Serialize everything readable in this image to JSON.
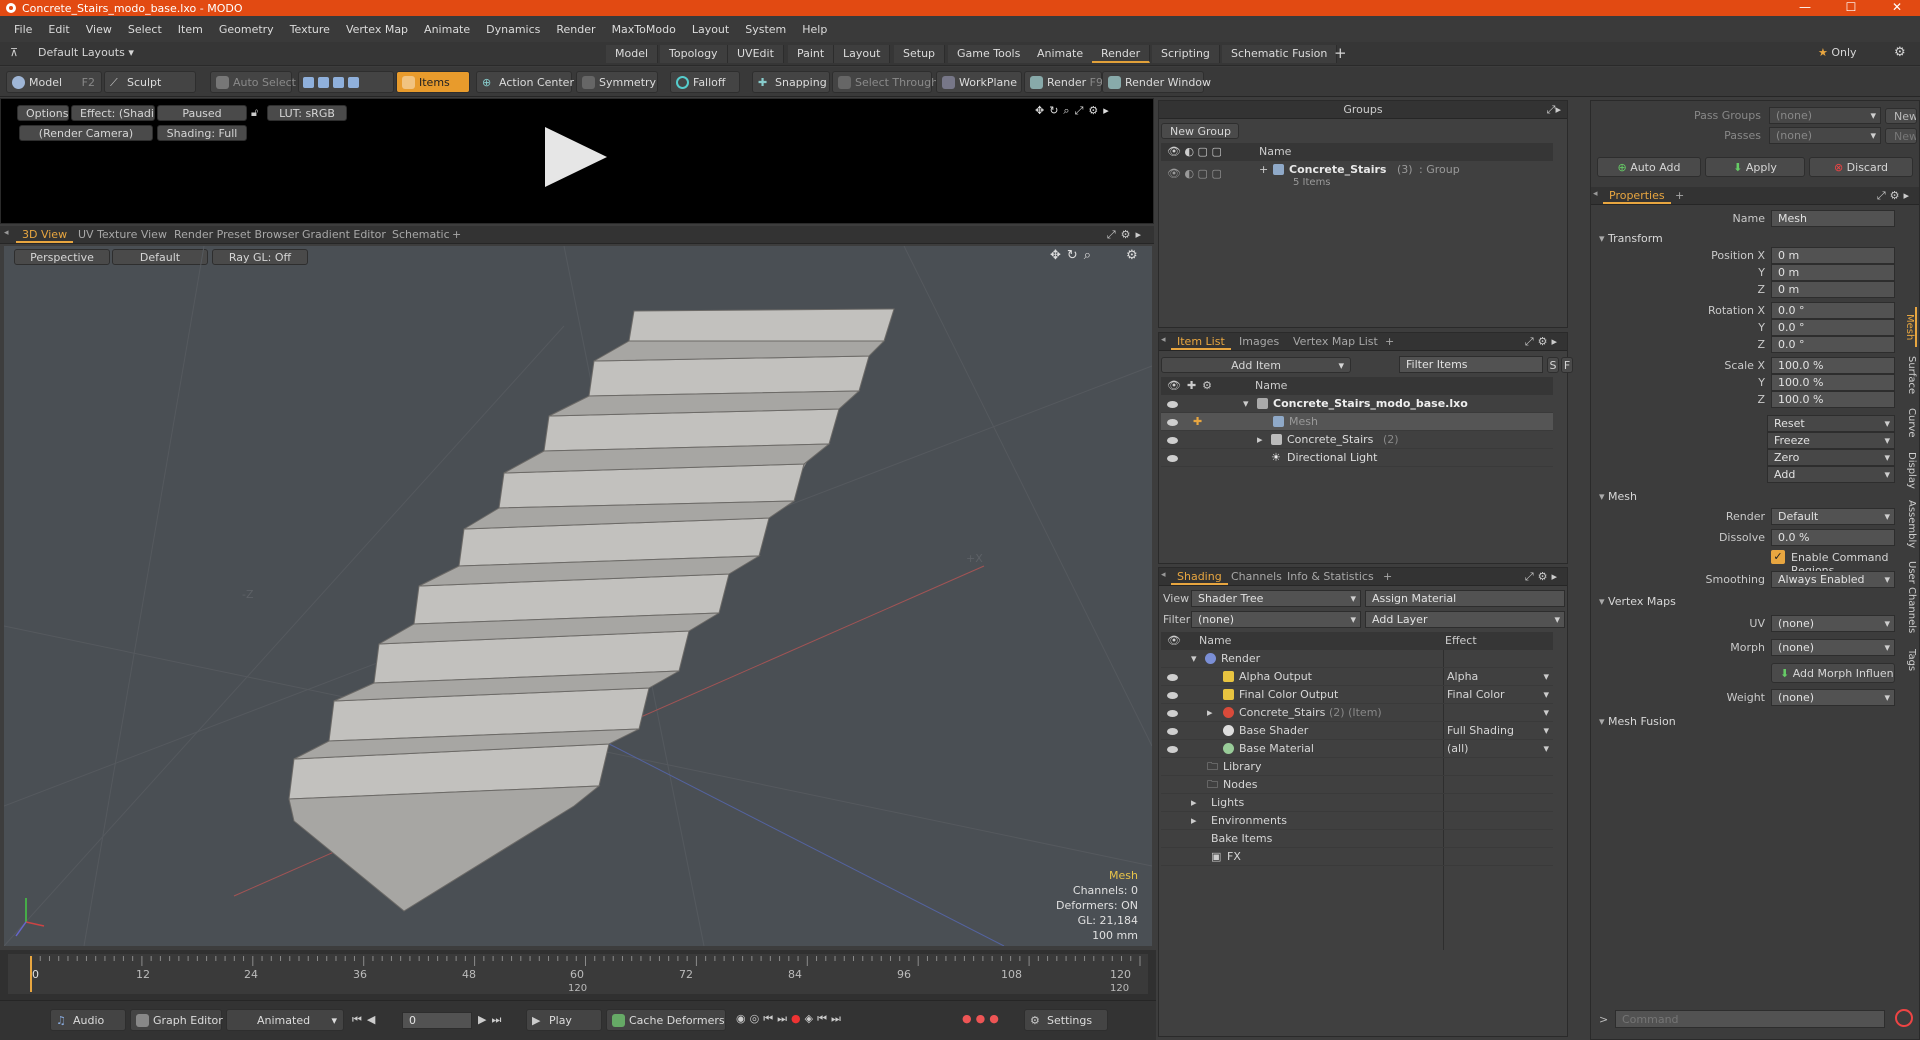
{
  "window": {
    "title": "Concrete_Stairs_modo_base.lxo - MODO"
  },
  "menu": [
    "File",
    "Edit",
    "View",
    "Select",
    "Item",
    "Geometry",
    "Texture",
    "Vertex Map",
    "Animate",
    "Dynamics",
    "Render",
    "MaxToModo",
    "Layout",
    "System",
    "Help"
  ],
  "layout_bar": {
    "preset": "Default Layouts",
    "tabs": [
      "Model",
      "Topology",
      "UVEdit",
      "Paint",
      "Layout",
      "Setup",
      "Game Tools",
      "Animate",
      "Render",
      "Scripting",
      "Schematic Fusion"
    ],
    "active": "Render",
    "only_label": "Only"
  },
  "toolbar": {
    "model": "Model",
    "model_key": "F2",
    "sculpt": "Sculpt",
    "auto_select": "Auto Select",
    "items": "Items",
    "action_center": "Action Center",
    "symmetry": "Symmetry",
    "falloff": "Falloff",
    "snapping": "Snapping",
    "select_through": "Select Through",
    "workplane": "WorkPlane",
    "render": "Render",
    "render_key": "F9",
    "render_window": "Render Window"
  },
  "preview": {
    "options": "Options",
    "effect": "Effect: (Shadi...",
    "paused": "Paused",
    "lut": "LUT: sRGB",
    "camera": "(Render Camera)",
    "shading": "Shading: Full"
  },
  "view_tabs": [
    "3D View",
    "UV Texture View",
    "Render Preset Browser",
    "Gradient Editor",
    "Schematic"
  ],
  "viewport": {
    "projection": "Perspective",
    "style": "Default",
    "raygl": "Ray GL: Off",
    "hud": {
      "type": "Mesh",
      "channels": "Channels: 0",
      "deformers": "Deformers: ON",
      "gl": "GL: 21,184",
      "unit": "100 mm"
    },
    "axis_z": "-Z",
    "axis_x": "+X"
  },
  "timeline": {
    "ticks": [
      "0",
      "12",
      "24",
      "36",
      "48",
      "60",
      "72",
      "84",
      "96",
      "108",
      "120"
    ],
    "mid": "120",
    "end": "120"
  },
  "bottom": {
    "audio": "Audio",
    "graph_editor": "Graph Editor",
    "animated": "Animated",
    "frame": "0",
    "play": "Play",
    "cache": "Cache Deformers",
    "settings": "Settings"
  },
  "groups": {
    "title": "Groups",
    "new_group": "New Group",
    "col_name": "Name",
    "item": "Concrete_Stairs",
    "item_count": "(3)",
    "item_type": ": Group",
    "item_sub": "5 Items"
  },
  "item_list": {
    "tabs": [
      "Item List",
      "Images",
      "Vertex Map List"
    ],
    "add_item": "Add Item",
    "filter": "Filter Items",
    "col_name": "Name",
    "rows": [
      {
        "label": "Concrete_Stairs_modo_base.lxo",
        "suffix": ""
      },
      {
        "label": "Mesh",
        "suffix": ""
      },
      {
        "label": "Concrete_Stairs",
        "suffix": "(2)"
      },
      {
        "label": "Directional Light",
        "suffix": ""
      }
    ]
  },
  "shading": {
    "tabs": [
      "Shading",
      "Channels",
      "Info & Statistics"
    ],
    "view_label": "View",
    "view_value": "Shader Tree",
    "assign": "Assign Material",
    "filter_label": "Filter",
    "filter_value": "(none)",
    "add_layer": "Add Layer",
    "col_name": "Name",
    "col_effect": "Effect",
    "rows": [
      {
        "name": "Render",
        "effect": ""
      },
      {
        "name": "Alpha Output",
        "effect": "Alpha"
      },
      {
        "name": "Final Color Output",
        "effect": "Final Color"
      },
      {
        "name": "Concrete_Stairs",
        "suffix": "(2) (Item)",
        "effect": ""
      },
      {
        "name": "Base Shader",
        "effect": "Full Shading"
      },
      {
        "name": "Base Material",
        "effect": "(all)"
      },
      {
        "name": "Library",
        "effect": ""
      },
      {
        "name": "Nodes",
        "effect": ""
      },
      {
        "name": "Lights",
        "effect": ""
      },
      {
        "name": "Environments",
        "effect": ""
      },
      {
        "name": "Bake Items",
        "effect": ""
      },
      {
        "name": "FX",
        "effect": ""
      }
    ]
  },
  "passes": {
    "pass_groups": "Pass Groups",
    "passes": "Passes",
    "none": "(none)",
    "new": "New",
    "auto_add": "Auto Add",
    "apply": "Apply",
    "discard": "Discard"
  },
  "properties": {
    "tab": "Properties",
    "name_label": "Name",
    "name_value": "Mesh",
    "transform": "Transform",
    "position_label": "Position X",
    "rotation_label": "Rotation X",
    "scale_label": "Scale X",
    "y": "Y",
    "z": "Z",
    "pos": [
      "0 m",
      "0 m",
      "0 m"
    ],
    "rot": [
      "0.0 °",
      "0.0 °",
      "0.0 °"
    ],
    "scale": [
      "100.0 %",
      "100.0 %",
      "100.0 %"
    ],
    "reset": "Reset",
    "freeze": "Freeze",
    "zero": "Zero",
    "add": "Add",
    "mesh": "Mesh",
    "render_label": "Render",
    "render_value": "Default",
    "dissolve_label": "Dissolve",
    "dissolve_value": "0.0 %",
    "enable_cmd": "Enable Command Regions",
    "smoothing_label": "Smoothing",
    "smoothing_value": "Always Enabled",
    "vertex_maps": "Vertex Maps",
    "uv_label": "UV",
    "morph_label": "Morph",
    "weight_label": "Weight",
    "add_morph": "Add Morph Influence",
    "mesh_fusion": "Mesh Fusion",
    "side_tabs": [
      "Mesh",
      "Surface",
      "Curve",
      "Display",
      "Assembly",
      "User Channels",
      "Tags"
    ]
  },
  "command": {
    "placeholder": "Command"
  }
}
